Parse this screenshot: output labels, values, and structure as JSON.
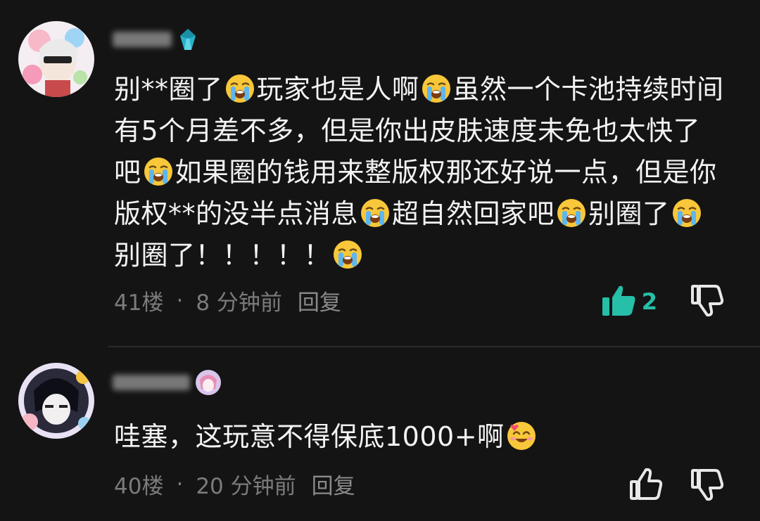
{
  "comments": [
    {
      "text_parts": [
        {
          "t": "text",
          "v": "别**圈了"
        },
        {
          "t": "emoji",
          "name": "loudly-crying-face"
        },
        {
          "t": "text",
          "v": "玩家也是人啊"
        },
        {
          "t": "emoji",
          "name": "loudly-crying-face"
        },
        {
          "t": "text",
          "v": "虽然一个卡池持续时间有5个月差不多，但是你出皮肤速度未免也太快了吧"
        },
        {
          "t": "emoji",
          "name": "loudly-crying-face"
        },
        {
          "t": "text",
          "v": "如果圈的钱用来整版权那还好说一点，但是你版权**的没半点消息"
        },
        {
          "t": "emoji",
          "name": "loudly-crying-face"
        },
        {
          "t": "text",
          "v": "超自然回家吧"
        },
        {
          "t": "emoji",
          "name": "loudly-crying-face"
        },
        {
          "t": "text",
          "v": "别圈了"
        },
        {
          "t": "emoji",
          "name": "loudly-crying-face"
        },
        {
          "t": "text",
          "v": "别圈了！！！！！"
        },
        {
          "t": "emoji",
          "name": "loudly-crying-face"
        }
      ],
      "floor": "41楼",
      "separator": "·",
      "time": "8 分钟前",
      "reply_label": "回复",
      "like_count": "2",
      "liked": true
    },
    {
      "text_parts": [
        {
          "t": "text",
          "v": "哇塞，这玩意不得保底1000+啊"
        },
        {
          "t": "emoji",
          "name": "smiling-face-with-hearts"
        }
      ],
      "floor": "40楼",
      "separator": "·",
      "time": "20 分钟前",
      "reply_label": "回复",
      "like_count": "",
      "liked": false
    }
  ],
  "colors": {
    "background": "#141414",
    "text": "#f3f3f3",
    "meta": "#7b7b7b",
    "like_active": "#26bfa8",
    "icon_inactive": "#e8e8e8"
  },
  "icons": {
    "like": "thumbs-up-icon",
    "dislike": "thumbs-down-icon"
  }
}
